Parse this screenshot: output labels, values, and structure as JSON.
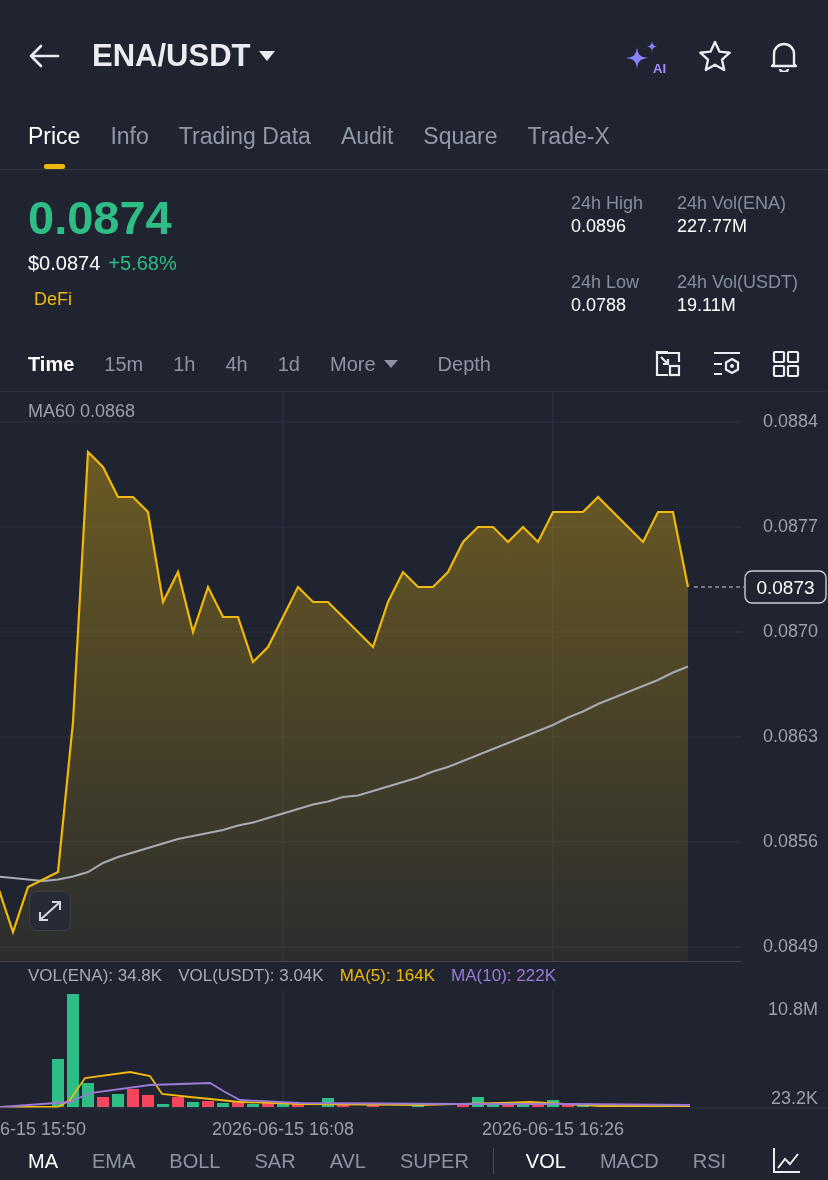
{
  "header": {
    "title": "ENA/USDT",
    "ai_label": "AI"
  },
  "tabs": [
    {
      "label": "Price",
      "selected": true
    },
    {
      "label": "Info",
      "selected": false
    },
    {
      "label": "Trading Data",
      "selected": false
    },
    {
      "label": "Audit",
      "selected": false
    },
    {
      "label": "Square",
      "selected": false
    },
    {
      "label": "Trade-X",
      "selected": false
    }
  ],
  "ticker": {
    "price": "0.0874",
    "usd_price": "$0.0874",
    "change": "+5.68%",
    "tag": "DeFi"
  },
  "stats": [
    {
      "label": "24h High",
      "value": "0.0896"
    },
    {
      "label": "24h Vol(ENA)",
      "value": "227.77M"
    },
    {
      "label": "24h Low",
      "value": "0.0788"
    },
    {
      "label": "24h Vol(USDT)",
      "value": "19.11M"
    }
  ],
  "intervals": [
    {
      "label": "Time",
      "selected": true,
      "kind": "plain"
    },
    {
      "label": "15m",
      "selected": false,
      "kind": "plain"
    },
    {
      "label": "1h",
      "selected": false,
      "kind": "plain"
    },
    {
      "label": "4h",
      "selected": false,
      "kind": "plain"
    },
    {
      "label": "1d",
      "selected": false,
      "kind": "plain"
    },
    {
      "label": "More",
      "selected": false,
      "kind": "dropdown"
    },
    {
      "label": "Depth",
      "selected": false,
      "kind": "plain"
    }
  ],
  "price_chart": {
    "ma_value": "0.0868",
    "last_price": "0.0873",
    "chart_data": {
      "type": "area",
      "series": [
        {
          "color": "#f0b90b",
          "values": [
            0.0853,
            0.085,
            0.0853,
            null,
            0.0854,
            0.0864,
            0.0882,
            0.0881,
            0.0879,
            0.0879,
            0.0878,
            0.0872,
            0.0874,
            0.087,
            0.0873,
            0.0871,
            0.0871,
            0.0868,
            0.0869,
            0.0871,
            0.0873,
            0.0872,
            0.0872,
            0.0871,
            0.087,
            0.0869,
            0.0872,
            0.0874,
            0.0873,
            0.0873,
            0.0874,
            0.0876,
            0.0877,
            0.0877,
            0.0876,
            0.0877,
            0.0876,
            0.0878,
            0.0878,
            0.0878,
            0.0879,
            0.0878,
            0.0877,
            0.0876,
            0.0878,
            0.0878,
            0.0873
          ]
        },
        {
          "name": "MA60",
          "type": "line",
          "color": "#a7abb5",
          "values": [
            0.08537,
            0.08536,
            0.08535,
            0.08534,
            0.08535,
            0.08537,
            0.0854,
            0.08546,
            0.0855,
            0.08553,
            0.08556,
            0.08559,
            0.08562,
            0.08564,
            0.08566,
            0.08568,
            0.08571,
            0.08573,
            0.08576,
            0.08579,
            0.08582,
            0.08585,
            0.08587,
            0.0859,
            0.08591,
            0.08594,
            0.08597,
            0.086,
            0.08603,
            0.08607,
            0.0861,
            0.08614,
            0.08618,
            0.08622,
            0.08626,
            0.0863,
            0.08634,
            0.08638,
            0.08643,
            0.08647,
            0.08652,
            0.08656,
            0.0866,
            0.08664,
            0.08668,
            0.08673,
            0.08677
          ]
        }
      ],
      "grid": true,
      "ylim": [
        0.0848,
        0.0886
      ],
      "yticks": [
        {
          "value": 0.0884,
          "label": "0.0884"
        },
        {
          "value": 0.0877,
          "label": "0.0877"
        },
        {
          "value": 0.087,
          "label": "0.0870"
        },
        {
          "value": 0.0863,
          "label": "0.0863"
        },
        {
          "value": 0.0856,
          "label": "0.0856"
        },
        {
          "value": 0.0849,
          "label": "0.0849"
        }
      ]
    }
  },
  "time_axis": [
    "6-15 15:50",
    "2026-06-15 16:08",
    "2026-06-15 16:26"
  ],
  "volume": {
    "legend": [
      {
        "label": "VOL(ENA): 34.8K",
        "color": "#a7abb5"
      },
      {
        "label": "VOL(USDT): 3.04K",
        "color": "#a7abb5"
      },
      {
        "label": "MA(5): 164K",
        "color": "#f0b90b"
      },
      {
        "label": "MA(10): 222K",
        "color": "#9b7ad8"
      }
    ],
    "max_label": "10.8M",
    "min_label": "23.2K"
  },
  "indicators": {
    "main": [
      {
        "label": "MA",
        "selected": true
      },
      {
        "label": "EMA",
        "selected": false
      },
      {
        "label": "BOLL",
        "selected": false
      },
      {
        "label": "SAR",
        "selected": false
      },
      {
        "label": "AVL",
        "selected": false
      },
      {
        "label": "SUPER",
        "selected": false
      }
    ],
    "sub": [
      {
        "label": "VOL",
        "selected": true
      },
      {
        "label": "MACD",
        "selected": false
      },
      {
        "label": "RSI",
        "selected": false
      }
    ]
  }
}
